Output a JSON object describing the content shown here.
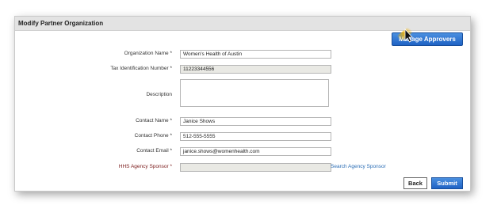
{
  "panel": {
    "title": "Modify Partner Organization",
    "manage_approvers_label": "Manage Approvers"
  },
  "form": {
    "org_name": {
      "label": "Organization Name *",
      "value": "Women's Health of Austin"
    },
    "tax_id": {
      "label": "Tax Identification Number *",
      "value": "11223344556"
    },
    "description": {
      "label": "Description",
      "value": ""
    },
    "contact_name": {
      "label": "Contact Name *",
      "value": "Janice Shows"
    },
    "contact_phone": {
      "label": "Contact Phone *",
      "value": "512-555-5555"
    },
    "contact_email": {
      "label": "Contact Email *",
      "value": "janice.shows@womenhealth.com"
    },
    "hhs_sponsor": {
      "label": "HHS Agency Sponsor *",
      "value": "",
      "link": "Search Agency Sponsor"
    }
  },
  "buttons": {
    "back": "Back",
    "submit": "Submit"
  },
  "colors": {
    "accent": "#1f62c4",
    "header_bg": "#e3e3e3",
    "link": "#2a6db5",
    "cursor_highlight": "#f5b400"
  }
}
